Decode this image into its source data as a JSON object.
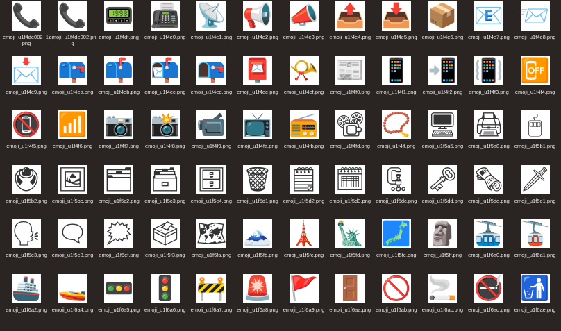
{
  "files": [
    {
      "label": "emoji_u1f4de002_1.png",
      "glyph": "📞",
      "icon": "telephone-receiver-icon"
    },
    {
      "label": "emoji_u1f4de002.png",
      "glyph": "📞",
      "icon": "telephone-receiver-icon"
    },
    {
      "label": "emoji_u1f4df.png",
      "glyph": "📟",
      "icon": "pager-icon"
    },
    {
      "label": "emoji_u1f4e0.png",
      "glyph": "📠",
      "icon": "fax-machine-icon"
    },
    {
      "label": "emoji_u1f4e1.png",
      "glyph": "📡",
      "icon": "satellite-antenna-icon"
    },
    {
      "label": "emoji_u1f4e2.png",
      "glyph": "📢",
      "icon": "loudspeaker-icon"
    },
    {
      "label": "emoji_u1f4e3.png",
      "glyph": "📣",
      "icon": "megaphone-icon"
    },
    {
      "label": "emoji_u1f4e4.png",
      "glyph": "📤",
      "icon": "outbox-tray-icon"
    },
    {
      "label": "emoji_u1f4e5.png",
      "glyph": "📥",
      "icon": "inbox-tray-icon"
    },
    {
      "label": "emoji_u1f4e6.png",
      "glyph": "📦",
      "icon": "package-icon"
    },
    {
      "label": "emoji_u1f4e7.png",
      "glyph": "📧",
      "icon": "e-mail-icon"
    },
    {
      "label": "emoji_u1f4e8.png",
      "glyph": "📨",
      "icon": "incoming-envelope-icon"
    },
    {
      "label": "emoji_u1f4e9.png",
      "glyph": "📩",
      "icon": "envelope-with-arrow-icon"
    },
    {
      "label": "emoji_u1f4ea.png",
      "glyph": "📪",
      "icon": "closed-mailbox-lowered-flag-icon"
    },
    {
      "label": "emoji_u1f4eb.png",
      "glyph": "📫",
      "icon": "closed-mailbox-raised-flag-icon"
    },
    {
      "label": "emoji_u1f4ec.png",
      "glyph": "📬",
      "icon": "open-mailbox-raised-flag-icon"
    },
    {
      "label": "emoji_u1f4ed.png",
      "glyph": "📭",
      "icon": "open-mailbox-lowered-flag-icon"
    },
    {
      "label": "emoji_u1f4ee.png",
      "glyph": "📮",
      "icon": "postbox-icon"
    },
    {
      "label": "emoji_u1f4ef.png",
      "glyph": "📯",
      "icon": "postal-horn-icon"
    },
    {
      "label": "emoji_u1f4f0.png",
      "glyph": "📰",
      "icon": "newspaper-icon"
    },
    {
      "label": "emoji_u1f4f1.png",
      "glyph": "📱",
      "icon": "mobile-phone-icon"
    },
    {
      "label": "emoji_u1f4f2.png",
      "glyph": "📲",
      "icon": "mobile-phone-with-arrow-icon"
    },
    {
      "label": "emoji_u1f4f3.png",
      "glyph": "📳",
      "icon": "vibration-mode-icon"
    },
    {
      "label": "emoji_u1f4f4.png",
      "glyph": "📴",
      "icon": "mobile-phone-off-icon"
    },
    {
      "label": "emoji_u1f4f5.png",
      "glyph": "📵",
      "icon": "no-mobile-phones-icon"
    },
    {
      "label": "emoji_u1f4f6.png",
      "glyph": "📶",
      "icon": "antenna-bars-icon"
    },
    {
      "label": "emoji_u1f4f7.png",
      "glyph": "📷",
      "icon": "camera-icon"
    },
    {
      "label": "emoji_u1f4f8.png",
      "glyph": "📸",
      "icon": "camera-with-flash-icon"
    },
    {
      "label": "emoji_u1f4f9.png",
      "glyph": "📹",
      "icon": "video-camera-icon"
    },
    {
      "label": "emoji_u1f4fa.png",
      "glyph": "📺",
      "icon": "television-icon"
    },
    {
      "label": "emoji_u1f4fb.png",
      "glyph": "📻",
      "icon": "radio-icon"
    },
    {
      "label": "emoji_u1f4fd.png",
      "glyph": "📽",
      "icon": "film-projector-icon"
    },
    {
      "label": "emoji_u1f4ff.png",
      "glyph": "📿",
      "icon": "prayer-beads-icon"
    },
    {
      "label": "emoji_u1f5a5.png",
      "glyph": "🖥",
      "icon": "desktop-computer-icon"
    },
    {
      "label": "emoji_u1f5a8.png",
      "glyph": "🖨",
      "icon": "printer-icon"
    },
    {
      "label": "emoji_u1f5b1.png",
      "glyph": "🖱",
      "icon": "computer-mouse-icon"
    },
    {
      "label": "emoji_u1f5b2.png",
      "glyph": "🖲",
      "icon": "trackball-icon"
    },
    {
      "label": "emoji_u1f5bc.png",
      "glyph": "🖼",
      "icon": "framed-picture-icon"
    },
    {
      "label": "emoji_u1f5c2.png",
      "glyph": "🗂",
      "icon": "card-index-dividers-icon"
    },
    {
      "label": "emoji_u1f5c3.png",
      "glyph": "🗃",
      "icon": "card-file-box-icon"
    },
    {
      "label": "emoji_u1f5c4.png",
      "glyph": "🗄",
      "icon": "file-cabinet-icon"
    },
    {
      "label": "emoji_u1f5d1.png",
      "glyph": "🗑",
      "icon": "wastebasket-icon"
    },
    {
      "label": "emoji_u1f5d2.png",
      "glyph": "🗒",
      "icon": "spiral-notepad-icon"
    },
    {
      "label": "emoji_u1f5d3.png",
      "glyph": "🗓",
      "icon": "spiral-calendar-icon"
    },
    {
      "label": "emoji_u1f5dc.png",
      "glyph": "🗜",
      "icon": "clamp-icon"
    },
    {
      "label": "emoji_u1f5dd.png",
      "glyph": "🗝",
      "icon": "old-key-icon"
    },
    {
      "label": "emoji_u1f5de.png",
      "glyph": "🗞",
      "icon": "rolled-newspaper-icon"
    },
    {
      "label": "emoji_u1f5e1.png",
      "glyph": "🗡",
      "icon": "dagger-icon"
    },
    {
      "label": "emoji_u1f5e3.png",
      "glyph": "🗣",
      "icon": "speaking-head-icon"
    },
    {
      "label": "emoji_u1f5e8.png",
      "glyph": "🗨",
      "icon": "speech-balloon-icon"
    },
    {
      "label": "emoji_u1f5ef.png",
      "glyph": "🗯",
      "icon": "anger-bubble-icon"
    },
    {
      "label": "emoji_u1f5f3.png",
      "glyph": "🗳",
      "icon": "ballot-box-icon"
    },
    {
      "label": "emoji_u1f5fa.png",
      "glyph": "🗺",
      "icon": "world-map-icon"
    },
    {
      "label": "emoji_u1f5fb.png",
      "glyph": "🗻",
      "icon": "mount-fuji-icon"
    },
    {
      "label": "emoji_u1f5fc.png",
      "glyph": "🗼",
      "icon": "tokyo-tower-icon"
    },
    {
      "label": "emoji_u1f5fd.png",
      "glyph": "🗽",
      "icon": "statue-of-liberty-icon"
    },
    {
      "label": "emoji_u1f5fe.png",
      "glyph": "🗾",
      "icon": "map-of-japan-icon"
    },
    {
      "label": "emoji_u1f5ff.png",
      "glyph": "🗿",
      "icon": "moai-icon"
    },
    {
      "label": "emoji_u1f6a0.png",
      "glyph": "🚠",
      "icon": "mountain-cableway-icon"
    },
    {
      "label": "emoji_u1f6a1.png",
      "glyph": "🚡",
      "icon": "aerial-tramway-icon"
    },
    {
      "label": "emoji_u1f6a2.png",
      "glyph": "🚢",
      "icon": "ship-icon"
    },
    {
      "label": "emoji_u1f6a4.png",
      "glyph": "🚤",
      "icon": "speedboat-icon"
    },
    {
      "label": "emoji_u1f6a5.png",
      "glyph": "🚥",
      "icon": "horizontal-traffic-light-icon"
    },
    {
      "label": "emoji_u1f6a6.png",
      "glyph": "🚦",
      "icon": "vertical-traffic-light-icon"
    },
    {
      "label": "emoji_u1f6a7.png",
      "glyph": "🚧",
      "icon": "construction-icon"
    },
    {
      "label": "emoji_u1f6a8.png",
      "glyph": "🚨",
      "icon": "police-car-light-icon"
    },
    {
      "label": "emoji_u1f6a9.png",
      "glyph": "🚩",
      "icon": "triangular-flag-icon"
    },
    {
      "label": "emoji_u1f6aa.png",
      "glyph": "🚪",
      "icon": "door-icon"
    },
    {
      "label": "emoji_u1f6ab.png",
      "glyph": "🚫",
      "icon": "prohibited-icon"
    },
    {
      "label": "emoji_u1f6ac.png",
      "glyph": "🚬",
      "icon": "cigarette-icon"
    },
    {
      "label": "emoji_u1f6ad.png",
      "glyph": "🚭",
      "icon": "no-smoking-icon"
    },
    {
      "label": "emoji_u1f6ae.png",
      "glyph": "🚮",
      "icon": "litter-in-bin-icon"
    }
  ]
}
